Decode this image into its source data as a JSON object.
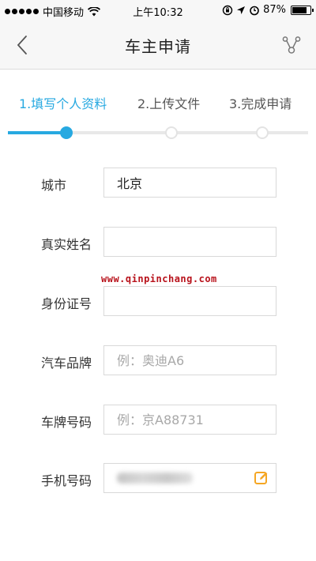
{
  "status_bar": {
    "carrier": "中国移动",
    "time": "上午10:32",
    "battery_percent_label": "87%",
    "battery_level": 0.87
  },
  "nav": {
    "title": "车主申请",
    "back_icon": "chevron-left-icon",
    "share_icon": "share-icon"
  },
  "steps": [
    {
      "label": "1.填写个人资料",
      "active": true
    },
    {
      "label": "2.上传文件",
      "active": false
    },
    {
      "label": "3.完成申请",
      "active": false
    }
  ],
  "form": {
    "city": {
      "label": "城市",
      "value": "北京",
      "placeholder": ""
    },
    "real_name": {
      "label": "真实姓名",
      "value": "",
      "placeholder": ""
    },
    "id_number": {
      "label": "身份证号",
      "value": "",
      "placeholder": ""
    },
    "car_brand": {
      "label": "汽车品牌",
      "value": "",
      "placeholder": "例：奥迪A6"
    },
    "plate_number": {
      "label": "车牌号码",
      "value": "",
      "placeholder": "例：京A88731"
    },
    "phone": {
      "label": "手机号码",
      "edit_icon": "edit-icon"
    }
  },
  "watermark": "www.qinpinchang.com",
  "colors": {
    "accent": "#27a9e1",
    "edit_icon": "#f5a623",
    "watermark": "#b8121b"
  }
}
